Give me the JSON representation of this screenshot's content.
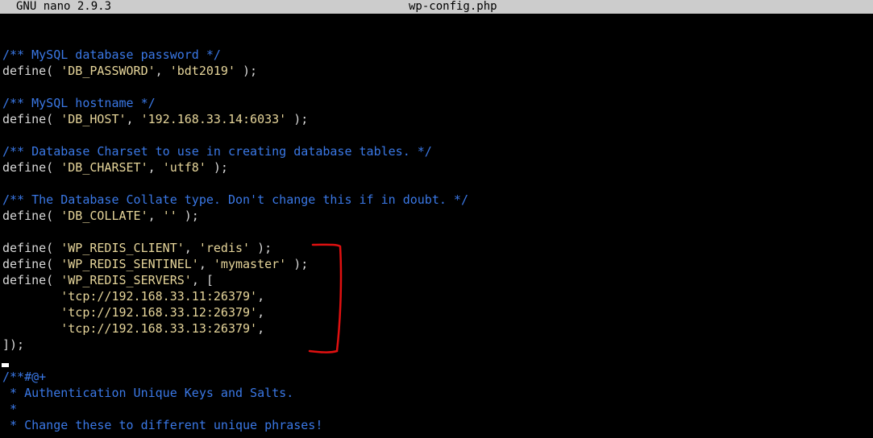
{
  "titlebar": {
    "app": "GNU nano 2.9.3",
    "filename": "wp-config.php"
  },
  "lines": [
    {
      "c": "/** MySQL database password */"
    },
    {
      "a": "define( ",
      "s": "'DB_PASSWORD'",
      "b": ", ",
      "s2": "'bdt2019'",
      "e": " );"
    },
    {
      "c": "/** MySQL hostname */"
    },
    {
      "a": "define( ",
      "s": "'DB_HOST'",
      "b": ", ",
      "s2": "'192.168.33.14:6033'",
      "e": " );"
    },
    {
      "c": "/** Database Charset to use in creating database tables. */"
    },
    {
      "a": "define( ",
      "s": "'DB_CHARSET'",
      "b": ", ",
      "s2": "'utf8'",
      "e": " );"
    },
    {
      "c": "/** The Database Collate type. Don't change this if in doubt. */"
    },
    {
      "a": "define( ",
      "s": "'DB_COLLATE'",
      "b": ", ",
      "s2": "''",
      "e": " );"
    },
    {
      "a": "define( ",
      "s": "'WP_REDIS_CLIENT'",
      "b": ", ",
      "s2": "'redis'",
      "e": " );"
    },
    {
      "a": "define( ",
      "s": "'WP_REDIS_SENTINEL'",
      "b": ", ",
      "s2": "'mymaster'",
      "e": " );"
    },
    {
      "a": "define( ",
      "s": "'WP_REDIS_SERVERS'",
      "b": ", [",
      "s2": "",
      "e": ""
    },
    {
      "a": "        ",
      "s": "'tcp://192.168.33.11:26379'",
      "b": ",",
      "s2": "",
      "e": ""
    },
    {
      "a": "        ",
      "s": "'tcp://192.168.33.12:26379'",
      "b": ",",
      "s2": "",
      "e": ""
    },
    {
      "a": "        ",
      "s": "'tcp://192.168.33.13:26379'",
      "b": ",",
      "s2": "",
      "e": ""
    },
    {
      "a": "]);",
      "s": "",
      "b": "",
      "s2": "",
      "e": ""
    },
    {
      "c": "/**#@+"
    },
    {
      "c": " * Authentication Unique Keys and Salts."
    },
    {
      "c": " *"
    },
    {
      "c": " * Change these to different unique phrases!"
    }
  ]
}
